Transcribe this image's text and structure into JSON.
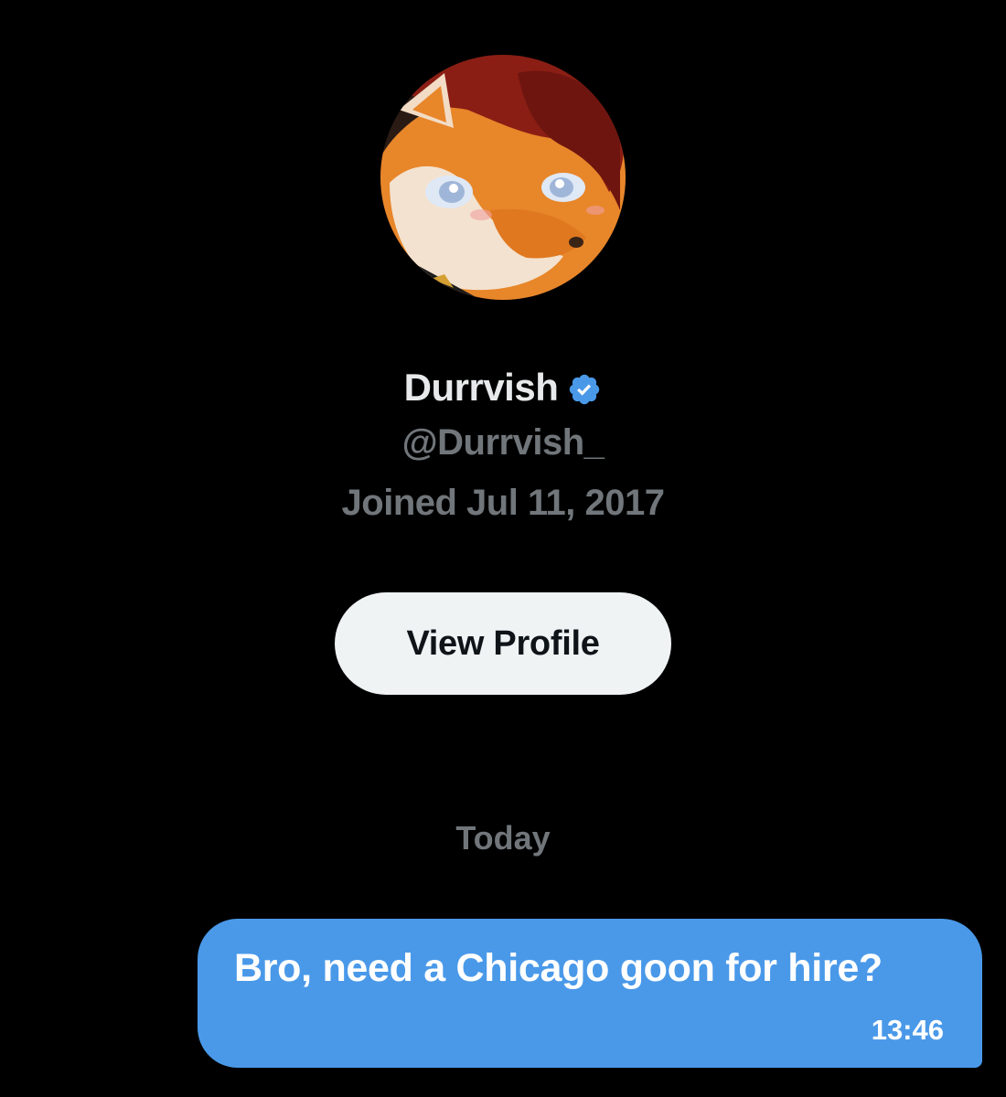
{
  "profile": {
    "display_name": "Durrvish",
    "verified": true,
    "handle": "@Durrvish_",
    "joined": "Joined Jul 11, 2017",
    "avatar_icon": "avatar-image"
  },
  "actions": {
    "view_profile_label": "View Profile"
  },
  "conversation": {
    "day_label": "Today",
    "messages": [
      {
        "text": "Bro, need a Chicago goon for hire?",
        "time": "13:46",
        "outgoing": true
      }
    ]
  },
  "colors": {
    "background": "#000000",
    "primary_text": "#e7e9ea",
    "secondary_text": "#71767b",
    "verified_badge": "#4a99e9",
    "button_bg": "#eff3f4",
    "outgoing_bubble": "#4a99e9"
  }
}
